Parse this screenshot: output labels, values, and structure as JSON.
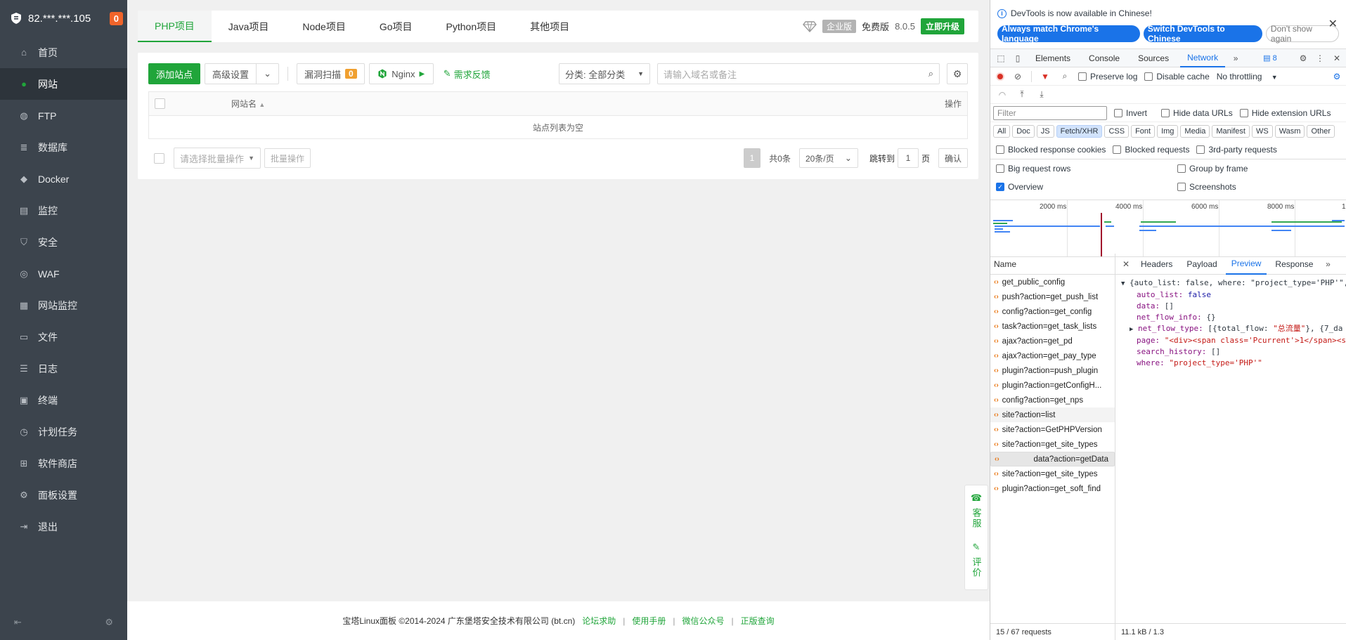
{
  "sidebar": {
    "host": "82.***.***.105",
    "badge": "0",
    "items": [
      {
        "label": "首页",
        "icon": "home-icon"
      },
      {
        "label": "网站",
        "icon": "globe-icon"
      },
      {
        "label": "FTP",
        "icon": "ftp-icon"
      },
      {
        "label": "数据库",
        "icon": "database-icon"
      },
      {
        "label": "Docker",
        "icon": "docker-icon"
      },
      {
        "label": "监控",
        "icon": "monitor-icon"
      },
      {
        "label": "安全",
        "icon": "shield-icon"
      },
      {
        "label": "WAF",
        "icon": "waf-icon"
      },
      {
        "label": "网站监控",
        "icon": "site-monitor-icon"
      },
      {
        "label": "文件",
        "icon": "folder-icon"
      },
      {
        "label": "日志",
        "icon": "log-icon"
      },
      {
        "label": "终端",
        "icon": "terminal-icon"
      },
      {
        "label": "计划任务",
        "icon": "calendar-icon"
      },
      {
        "label": "软件商店",
        "icon": "grid-icon"
      },
      {
        "label": "面板设置",
        "icon": "gear-icon"
      },
      {
        "label": "退出",
        "icon": "logout-icon"
      }
    ]
  },
  "tabs": [
    "PHP项目",
    "Java项目",
    "Node项目",
    "Go项目",
    "Python项目",
    "其他项目"
  ],
  "edition": {
    "enterprise": "企业版",
    "free": "免费版",
    "version": "8.0.5",
    "upgrade": "立即升级"
  },
  "toolbar": {
    "add_site": "添加站点",
    "advanced": "高级设置",
    "vuln_scan": "漏洞扫描",
    "vuln_count": "0",
    "nginx": "Nginx",
    "feedback": "需求反馈",
    "category": "分类: 全部分类",
    "search_placeholder": "请输入域名或备注"
  },
  "table": {
    "col_name": "网站名",
    "col_action": "操作",
    "empty": "站点列表为空"
  },
  "pager": {
    "batch_placeholder": "请选择批量操作",
    "batch_btn": "批量操作",
    "current": "1",
    "total": "共0条",
    "per_page": "20条/页",
    "goto": "跳转到",
    "goto_value": "1",
    "page_unit": "页",
    "confirm": "确认"
  },
  "footer": {
    "copyright": "宝塔Linux面板 ©2014-2024 广东堡塔安全技术有限公司 (bt.cn)",
    "links": [
      "论坛求助",
      "使用手册",
      "微信公众号",
      "正版查询"
    ]
  },
  "float": {
    "service": "客服",
    "rate": "评价"
  },
  "devtools": {
    "notice": "DevTools is now available in Chinese!",
    "btn_match": "Always match Chrome's language",
    "btn_switch": "Switch DevTools to Chinese",
    "btn_dismiss": "Don't show again",
    "tabs": [
      "Elements",
      "Console",
      "Sources",
      "Network"
    ],
    "issues": "8",
    "preserve_log": "Preserve log",
    "disable_cache": "Disable cache",
    "throttling": "No throttling",
    "filter_placeholder": "Filter",
    "invert": "Invert",
    "hide_data_urls": "Hide data URLs",
    "hide_ext_urls": "Hide extension URLs",
    "types": [
      "All",
      "Doc",
      "JS",
      "Fetch/XHR",
      "CSS",
      "Font",
      "Img",
      "Media",
      "Manifest",
      "WS",
      "Wasm",
      "Other"
    ],
    "blocked_cookies": "Blocked response cookies",
    "blocked_requests": "Blocked requests",
    "third_party": "3rd-party requests",
    "big_rows": "Big request rows",
    "group_frame": "Group by frame",
    "overview": "Overview",
    "screenshots": "Screenshots",
    "timeline": [
      "2000 ms",
      "4000 ms",
      "6000 ms",
      "8000 ms",
      "1"
    ],
    "name_header": "Name",
    "requests": [
      "get_public_config",
      "push?action=get_push_list",
      "config?action=get_config",
      "task?action=get_task_lists",
      "ajax?action=get_pd",
      "ajax?action=get_pay_type",
      "plugin?action=push_plugin",
      "plugin?action=getConfigH...",
      "config?action=get_nps",
      "site?action=list",
      "site?action=GetPHPVersion",
      "site?action=get_site_types",
      "data?action=getData",
      "site?action=get_site_types",
      "plugin?action=get_soft_find"
    ],
    "detail_tabs": [
      "Headers",
      "Payload",
      "Preview",
      "Response"
    ],
    "preview": {
      "root": "{auto_list: false, where: \"project_type='PHP'\",",
      "auto_list_key": "auto_list:",
      "auto_list_val": "false",
      "data_key": "data:",
      "data_val": "[]",
      "nfi_key": "net_flow_info:",
      "nfi_val": "{}",
      "nft_key": "net_flow_type:",
      "nft_val1": "[{total_flow: ",
      "nft_str": "\"总流量\"",
      "nft_val2": "}, {7_da",
      "page_key": "page:",
      "page_val": "\"<div><span class='Pcurrent'>1</span><s",
      "sh_key": "search_history:",
      "sh_val": "[]",
      "where_key": "where:",
      "where_val": "\"project_type='PHP'\""
    },
    "status_left": "15 / 67 requests",
    "status_right": "11.1 kB / 1.3"
  }
}
